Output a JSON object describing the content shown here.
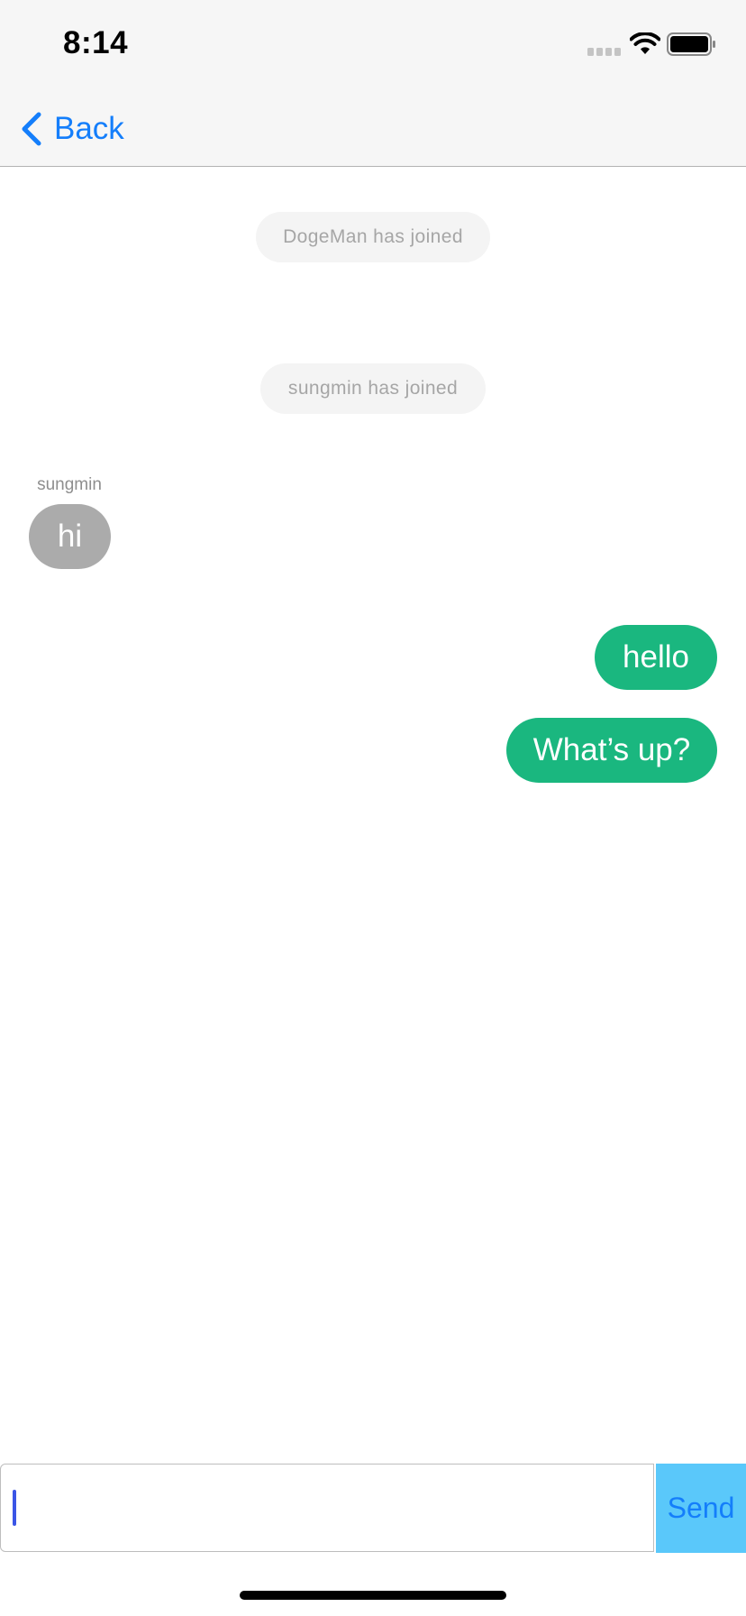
{
  "status_bar": {
    "time": "8:14",
    "icons": [
      "signal-icon",
      "wifi-icon",
      "battery-icon"
    ]
  },
  "nav": {
    "back_label": "Back",
    "back_icon": "chevron-left-icon"
  },
  "system_messages": [
    "DogeMan has joined",
    "sungmin has joined"
  ],
  "messages": [
    {
      "direction": "incoming",
      "sender": "sungmin",
      "text": "hi"
    },
    {
      "direction": "outgoing",
      "text": "hello"
    },
    {
      "direction": "outgoing",
      "text": "What’s up?"
    }
  ],
  "composer": {
    "value": "",
    "placeholder": "",
    "send_label": "Send"
  },
  "colors": {
    "accent": "#147efb",
    "outgoing_bubble": "#1ab77f",
    "incoming_bubble": "#ababab",
    "send_button_bg": "#5ac8fa",
    "bar_bg": "#f6f6f6"
  }
}
